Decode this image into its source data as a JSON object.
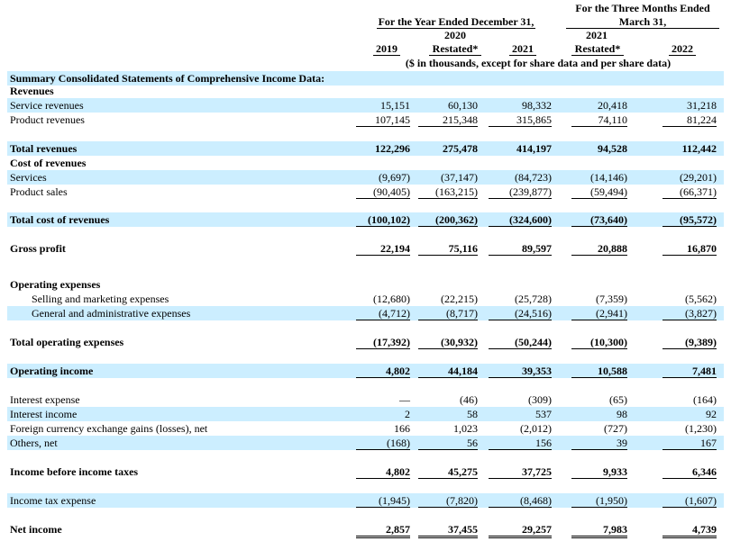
{
  "header": {
    "year_group": "For the Year Ended December 31,",
    "quarter_group_line1": "For the Three Months Ended",
    "quarter_group_line2": "March 31,",
    "col2020_line1": "2020",
    "col2021q_line1": "2021",
    "columns": [
      "2019",
      "Restated*",
      "2021",
      "Restated*",
      "2022"
    ],
    "units": "($ in thousands, except for share data and per share data)"
  },
  "section_title": "Summary Consolidated Statements of Comprehensive Income Data:",
  "rows": [
    {
      "label": "Revenues",
      "values": []
    },
    {
      "label": "Service revenues",
      "values": [
        "15,151",
        "60,130",
        "98,332",
        "20,418",
        "31,218"
      ]
    },
    {
      "label": "Product revenues",
      "values": [
        "107,145",
        "215,348",
        "315,865",
        "74,110",
        "81,224"
      ]
    },
    {
      "label": "Total revenues",
      "values": [
        "122,296",
        "275,478",
        "414,197",
        "94,528",
        "112,442"
      ]
    },
    {
      "label": "Cost of revenues",
      "values": []
    },
    {
      "label": "Services",
      "values": [
        "(9,697)",
        "(37,147)",
        "(84,723)",
        "(14,146)",
        "(29,201)"
      ]
    },
    {
      "label": "Product sales",
      "values": [
        "(90,405)",
        "(163,215)",
        "(239,877)",
        "(59,494)",
        "(66,371)"
      ]
    },
    {
      "label": "Total cost of revenues",
      "values": [
        "(100,102)",
        "(200,362)",
        "(324,600)",
        "(73,640)",
        "(95,572)"
      ]
    },
    {
      "label": "Gross profit",
      "values": [
        "22,194",
        "75,116",
        "89,597",
        "20,888",
        "16,870"
      ]
    },
    {
      "label": "Operating expenses",
      "values": []
    },
    {
      "label": "Selling and marketing expenses",
      "values": [
        "(12,680)",
        "(22,215)",
        "(25,728)",
        "(7,359)",
        "(5,562)"
      ]
    },
    {
      "label": "General and administrative expenses",
      "values": [
        "(4,712)",
        "(8,717)",
        "(24,516)",
        "(2,941)",
        "(3,827)"
      ]
    },
    {
      "label": "Total operating expenses",
      "values": [
        "(17,392)",
        "(30,932)",
        "(50,244)",
        "(10,300)",
        "(9,389)"
      ]
    },
    {
      "label": "Operating income",
      "values": [
        "4,802",
        "44,184",
        "39,353",
        "10,588",
        "7,481"
      ]
    },
    {
      "label": "Interest expense",
      "values": [
        "—",
        "(46)",
        "(309)",
        "(65)",
        "(164)"
      ]
    },
    {
      "label": "Interest income",
      "values": [
        "2",
        "58",
        "537",
        "98",
        "92"
      ]
    },
    {
      "label": "Foreign currency exchange gains (losses), net",
      "values": [
        "166",
        "1,023",
        "(2,012)",
        "(727)",
        "(1,230)"
      ]
    },
    {
      "label": "Others, net",
      "values": [
        "(168)",
        "56",
        "156",
        "39",
        "167"
      ]
    },
    {
      "label": "Income before income taxes",
      "values": [
        "4,802",
        "45,275",
        "37,725",
        "9,933",
        "6,346"
      ]
    },
    {
      "label": "Income tax expense",
      "values": [
        "(1,945)",
        "(7,820)",
        "(8,468)",
        "(1,950)",
        "(1,607)"
      ]
    },
    {
      "label": "Net income",
      "values": [
        "2,857",
        "37,455",
        "29,257",
        "7,983",
        "4,739"
      ]
    }
  ]
}
